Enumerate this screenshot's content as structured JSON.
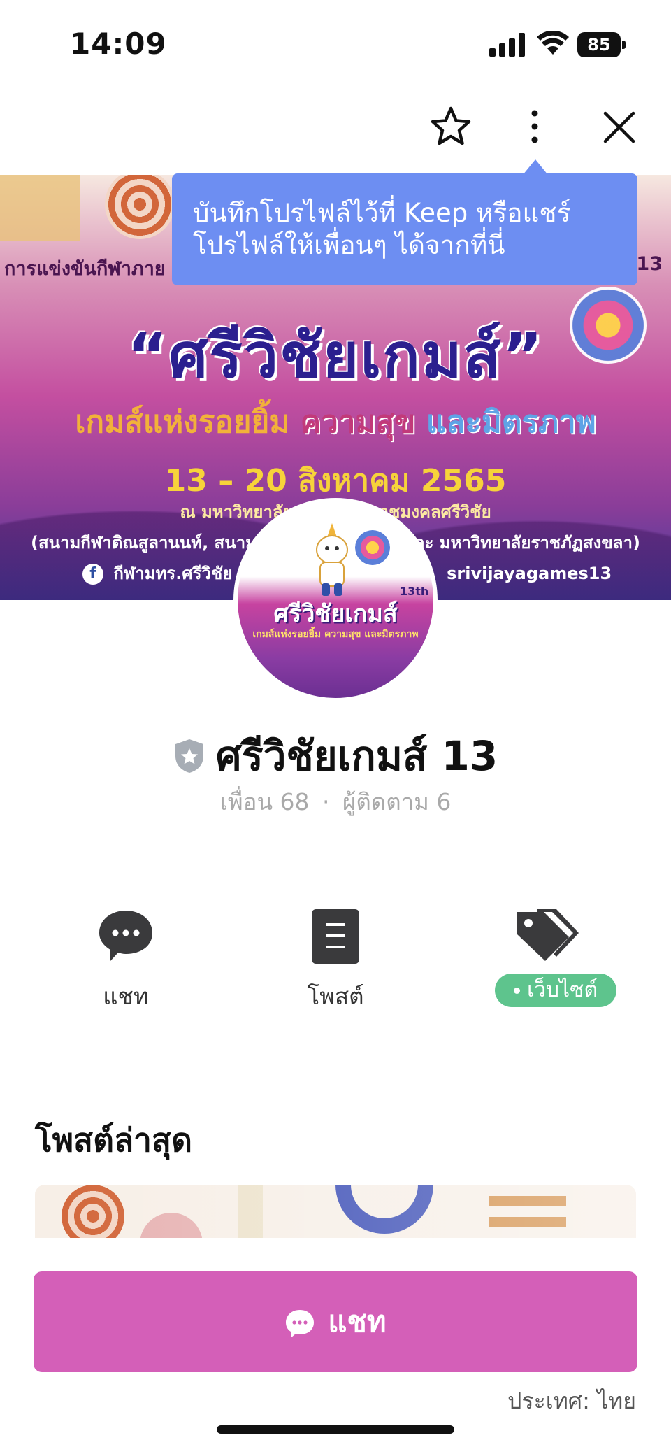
{
  "status_bar": {
    "time": "14:09",
    "battery": "85",
    "icons": [
      "signal-icon",
      "wifi-icon",
      "battery-icon"
    ]
  },
  "top_bar": {
    "icons": [
      "star-icon",
      "more-icon",
      "close-icon"
    ]
  },
  "tooltip": {
    "line1": "บันทึกโปรไฟล์ไว้ที่ Keep หรือแชร์",
    "line2": "โปรไฟล์ให้เพื่อนๆ ได้จากที่นี่"
  },
  "cover": {
    "line1": "การแข่งขันกีฬาภาย",
    "line1_end": "13",
    "title": "“ศรีวิชัยเกมส์”",
    "subtitle_part1": "เกมส์แห่งรอยยิ้ม",
    "subtitle_part2": "ความสุข",
    "subtitle_part3": "และมิตรภาพ",
    "dates": "13 – 20 สิงหาคม 2565",
    "venue": "ณ มหาวิทยาลัยเทคโนโลยีราชมงคลศรีวิชัย",
    "venues_line": "(สนามกีฬาติณสูลานนท์, สนามแบดมินตัน ... ทัศน์ และ มหาวิทยาลัยราชภัฏสงขลา)",
    "social": "กีฬามทร.ศรีวิชัย",
    "social_tag": "srivijayagames13"
  },
  "avatar": {
    "name": "ศรีวิชัยเกมส์",
    "sup": "13th",
    "slogan": "เกมส์แห่งรอยยิ้ม ความสุข และมิตรภาพ"
  },
  "profile": {
    "name": "ศรีวิชัยเกมส์ 13",
    "friends_label": "เพื่อน 68",
    "followers_label": "ผู้ติดตาม 6",
    "separator": "·"
  },
  "actions": [
    {
      "label": "แชท",
      "icon": "chat-icon"
    },
    {
      "label": "โพสต์",
      "icon": "post-icon"
    },
    {
      "label": "เว็บไซต์",
      "icon": "tag-icon"
    }
  ],
  "latest_posts": {
    "title": "โพสต์ล่าสุด"
  },
  "chat_button": {
    "label": "แชท",
    "icon": "chat-bubble-icon",
    "color": "#d45fb8"
  },
  "country": "ประเทศ: ไทย",
  "colors": {
    "tooltip": "#6d8ef2",
    "website_badge": "#5ec48d",
    "chat_button": "#d45fb8"
  }
}
